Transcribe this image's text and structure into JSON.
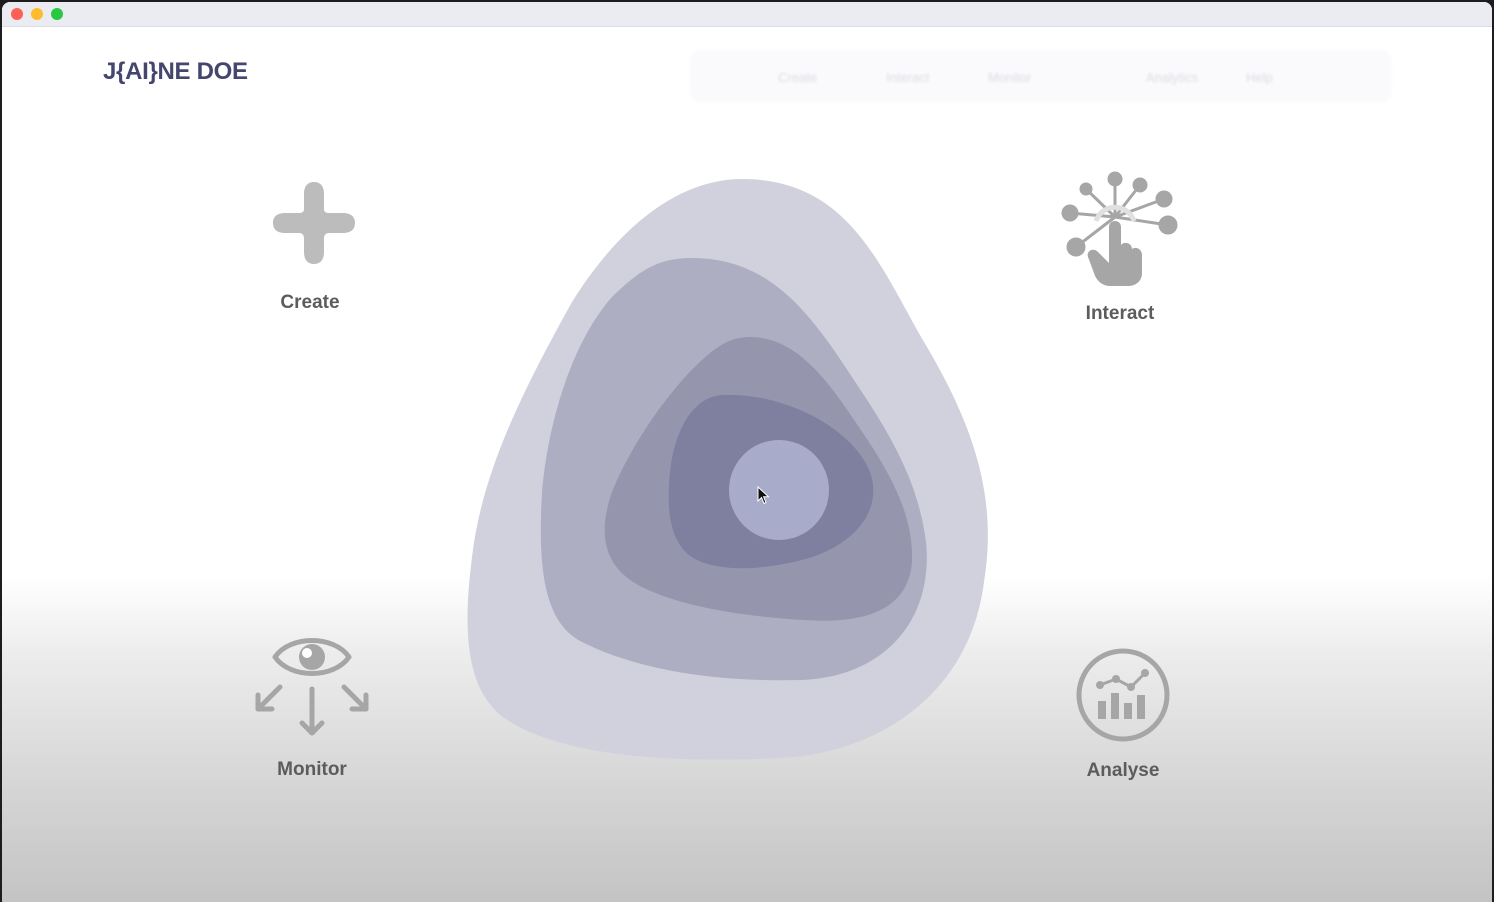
{
  "brand": "J{AI}NE DOE",
  "nav": {
    "items": [
      "Create",
      "Interact",
      "Monitor",
      "Analytics",
      "Help"
    ]
  },
  "features": {
    "create": {
      "label": "Create",
      "icon": "plus-icon"
    },
    "interact": {
      "label": "Interact",
      "icon": "touch-network-icon"
    },
    "monitor": {
      "label": "Monitor",
      "icon": "eye-arrows-icon"
    },
    "analyse": {
      "label": "Analyse",
      "icon": "chart-circle-icon"
    }
  },
  "colors": {
    "brand": "#45466e",
    "icon_gray": "#a6a6a6",
    "label_gray": "#5c5c5c",
    "blob_layers": [
      "#d1d1dd",
      "#adaec2",
      "#9596ae",
      "#7f809f",
      "#a9abcb"
    ]
  }
}
